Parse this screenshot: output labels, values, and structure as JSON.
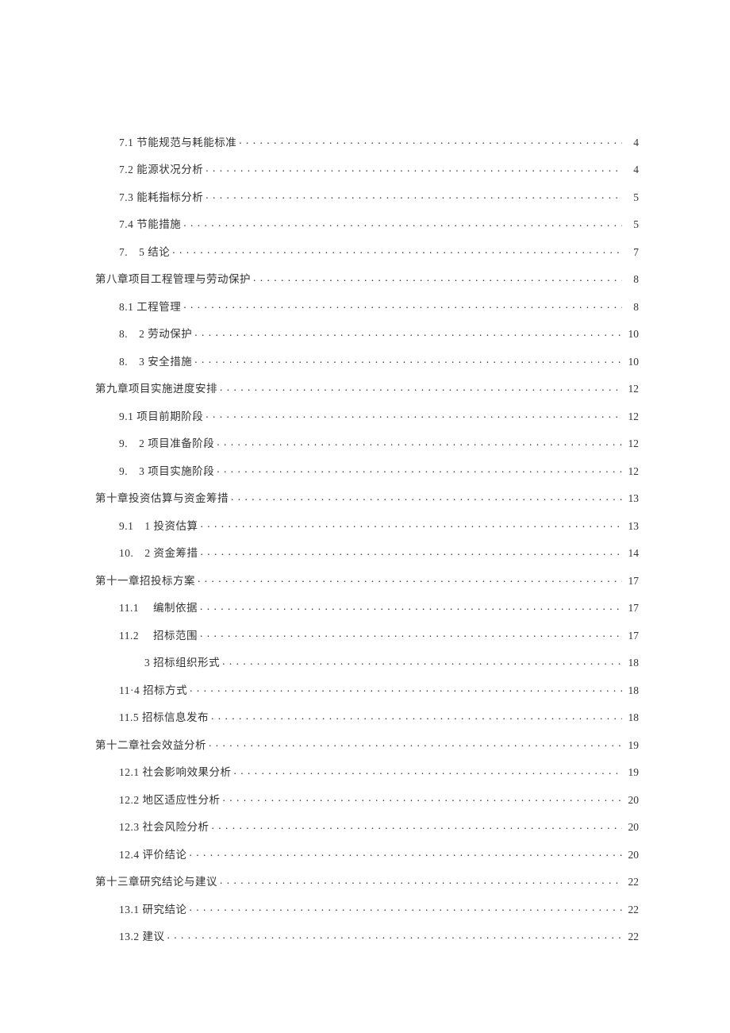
{
  "toc": [
    {
      "level": "sub",
      "label": "7.1 节能规范与耗能标准",
      "page": "4"
    },
    {
      "level": "sub",
      "label": "7.2 能源状况分析",
      "page": "4"
    },
    {
      "level": "sub",
      "label": "7.3 能耗指标分析",
      "page": "5"
    },
    {
      "level": "sub",
      "label": "7.4 节能措施",
      "page": "5"
    },
    {
      "level": "sub",
      "label": "7.　5 结论",
      "page": "7"
    },
    {
      "level": "chapter",
      "label": "第八章项目工程管理与劳动保护 ",
      "page": "8"
    },
    {
      "level": "sub",
      "label": "8.1 工程管理",
      "page": "8"
    },
    {
      "level": "sub",
      "label": "8.　2 劳动保护",
      "page": "10"
    },
    {
      "level": "sub",
      "label": "8.　3 安全措施",
      "page": "10"
    },
    {
      "level": "chapter",
      "label": "第九章项目实施进度安排 ",
      "page": "12"
    },
    {
      "level": "sub",
      "label": "9.1 项目前期阶段",
      "page": "12"
    },
    {
      "level": "sub",
      "label": "9.　2 项目准备阶段",
      "page": "12"
    },
    {
      "level": "sub",
      "label": "9.　3 项目实施阶段",
      "page": "12"
    },
    {
      "level": "chapter",
      "label": "第十章投资估算与资金筹措 ",
      "page": "13"
    },
    {
      "level": "sub",
      "label": "9.1　1 投资估算",
      "page": "13"
    },
    {
      "level": "sub",
      "label": "10.　2 资金筹措",
      "page": "14"
    },
    {
      "level": "chapter",
      "label": "第十一章招投标方案 ",
      "page": "17"
    },
    {
      "level": "sub",
      "label": "11.1　 编制依据",
      "page": "17"
    },
    {
      "level": "sub",
      "label": "11.2　 招标范围",
      "page": "17"
    },
    {
      "level": "sub-extra",
      "label": "3 招标组织形式",
      "page": "18"
    },
    {
      "level": "sub",
      "label": "11·4 招标方式",
      "page": "18"
    },
    {
      "level": "sub",
      "label": "11.5 招标信息发布",
      "page": "18"
    },
    {
      "level": "chapter",
      "label": "第十二章社会效益分析 ",
      "page": "19"
    },
    {
      "level": "sub",
      "label": "12.1 社会影响效果分析",
      "page": "19"
    },
    {
      "level": "sub",
      "label": "12.2 地区适应性分析",
      "page": "20"
    },
    {
      "level": "sub",
      "label": "12.3 社会风险分析",
      "page": "20"
    },
    {
      "level": "sub",
      "label": "12.4 评价结论",
      "page": "20"
    },
    {
      "level": "chapter",
      "label": "第十三章研究结论与建议 ",
      "page": "22"
    },
    {
      "level": "sub",
      "label": "13.1 研究结论",
      "page": "22"
    },
    {
      "level": "sub",
      "label": "13.2 建议",
      "page": "22"
    }
  ]
}
